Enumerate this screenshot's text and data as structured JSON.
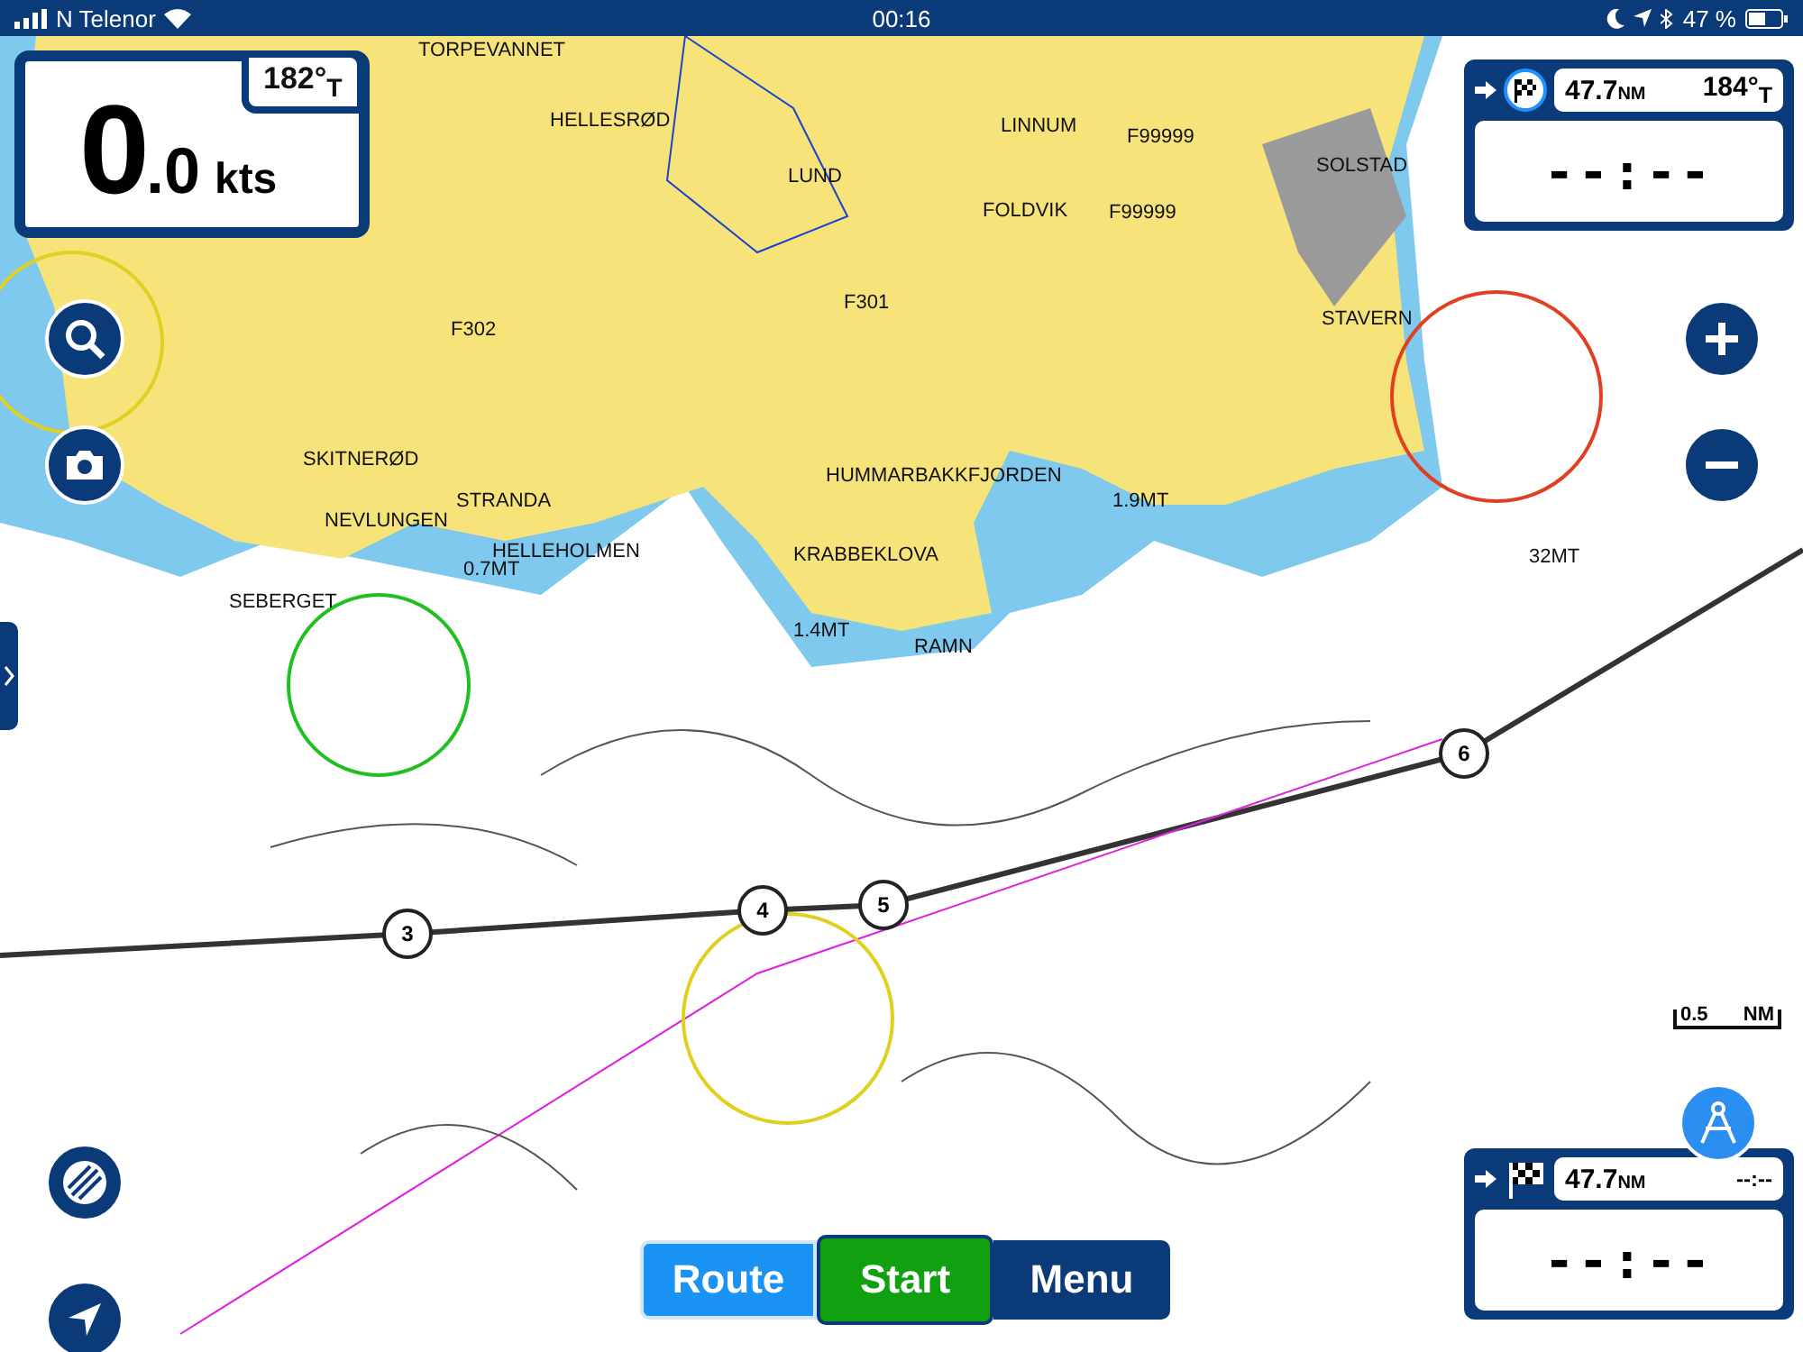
{
  "status_bar": {
    "carrier": "N Telenor",
    "time": "00:16",
    "battery": "47 %"
  },
  "speed_panel": {
    "heading": "182°$_{T}$",
    "speed_whole": "0",
    "speed_decimal": ".0",
    "unit": "kts"
  },
  "waypoint_panel": {
    "distance": "47.7",
    "distance_unit": "NM",
    "bearing": "184°$_{T}$",
    "time": "--:--"
  },
  "destination_panel": {
    "distance": "47.7",
    "distance_unit": "NM",
    "eta": "--:--",
    "time": "--:--"
  },
  "map_labels": [
    "TORPEVANNET",
    "HELLESRØD",
    "LUND",
    "LINNUM",
    "F99999",
    "FOLDVIK",
    "F99999",
    "SOLSTAD",
    "F302",
    "F301",
    "STAVERN",
    "SKITNERØD",
    "STRANDA",
    "NEVLUNGEN",
    "HELLEHOLMEN",
    "0.7MT",
    "SEBERGET",
    "HUMMARBAKKFJORDEN",
    "KRABBEKLOVA",
    "1.9MT",
    "32MT",
    "1.4MT",
    "RAMN"
  ],
  "route_waypoints": [
    "3",
    "4",
    "5",
    "6"
  ],
  "scale": {
    "value": "0.5",
    "unit": "NM"
  },
  "bottom_buttons": [
    {
      "label": "Route",
      "kind": "route"
    },
    {
      "label": "Start",
      "kind": "start"
    },
    {
      "label": "Menu",
      "kind": "menu"
    }
  ]
}
